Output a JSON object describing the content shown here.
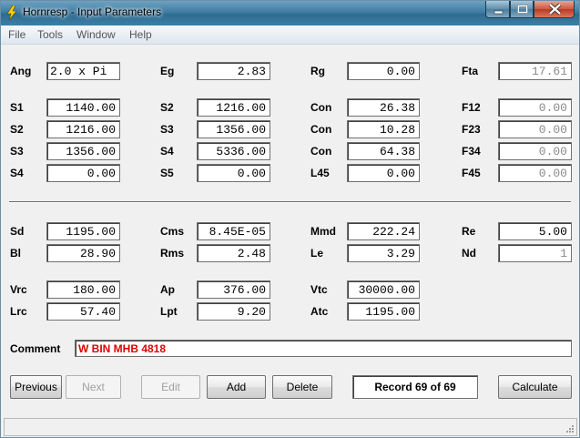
{
  "window": {
    "title": "Hornresp - Input Parameters"
  },
  "menu": [
    "File",
    "Tools",
    "Window",
    "Help"
  ],
  "fields": {
    "ang": {
      "label": "Ang",
      "value": "2.0 x Pi"
    },
    "eg": {
      "label": "Eg",
      "value": "2.83"
    },
    "rg": {
      "label": "Rg",
      "value": "0.00"
    },
    "fta": {
      "label": "Fta",
      "value": "17.61"
    },
    "s1": {
      "label": "S1",
      "value": "1140.00"
    },
    "s2a": {
      "label": "S2",
      "value": "1216.00"
    },
    "con1": {
      "label": "Con",
      "value": "26.38"
    },
    "f12": {
      "label": "F12",
      "value": "0.00"
    },
    "s2b": {
      "label": "S2",
      "value": "1216.00"
    },
    "s3a": {
      "label": "S3",
      "value": "1356.00"
    },
    "con2": {
      "label": "Con",
      "value": "10.28"
    },
    "f23": {
      "label": "F23",
      "value": "0.00"
    },
    "s3b": {
      "label": "S3",
      "value": "1356.00"
    },
    "s4a": {
      "label": "S4",
      "value": "5336.00"
    },
    "con3": {
      "label": "Con",
      "value": "64.38"
    },
    "f34": {
      "label": "F34",
      "value": "0.00"
    },
    "s4b": {
      "label": "S4",
      "value": "0.00"
    },
    "s5": {
      "label": "S5",
      "value": "0.00"
    },
    "l45": {
      "label": "L45",
      "value": "0.00"
    },
    "f45": {
      "label": "F45",
      "value": "0.00"
    },
    "sd": {
      "label": "Sd",
      "value": "1195.00"
    },
    "cms": {
      "label": "Cms",
      "value": "8.45E-05"
    },
    "mmd": {
      "label": "Mmd",
      "value": "222.24"
    },
    "re": {
      "label": "Re",
      "value": "5.00"
    },
    "bl": {
      "label": "Bl",
      "value": "28.90"
    },
    "rms": {
      "label": "Rms",
      "value": "2.48"
    },
    "le": {
      "label": "Le",
      "value": "3.29"
    },
    "nd": {
      "label": "Nd",
      "value": "1"
    },
    "vrc": {
      "label": "Vrc",
      "value": "180.00"
    },
    "ap": {
      "label": "Ap",
      "value": "376.00"
    },
    "vtc": {
      "label": "Vtc",
      "value": "30000.00"
    },
    "lrc": {
      "label": "Lrc",
      "value": "57.40"
    },
    "lpt": {
      "label": "Lpt",
      "value": "9.20"
    },
    "atc": {
      "label": "Atc",
      "value": "1195.00"
    }
  },
  "comment": {
    "label": "Comment",
    "value": "W BIN MHB 4818"
  },
  "buttons": {
    "previous": "Previous",
    "next": "Next",
    "edit": "Edit",
    "add": "Add",
    "delete": "Delete",
    "calculate": "Calculate"
  },
  "record": "Record 69 of 69",
  "colors": {
    "comment_text": "#e00000",
    "titlebar": "#3f7da3"
  }
}
